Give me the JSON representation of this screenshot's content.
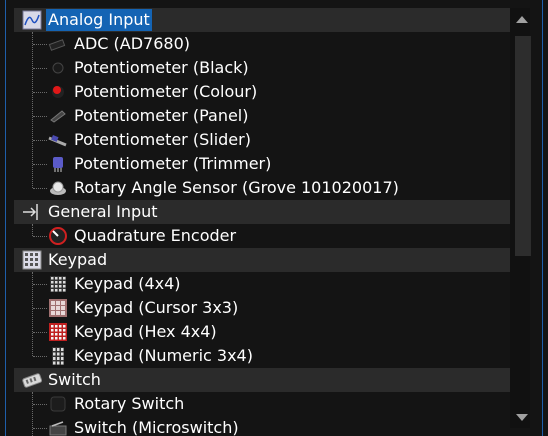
{
  "tree": {
    "categories": [
      {
        "label": "Analog Input",
        "icon": "analog-input-icon",
        "selected": true,
        "children": [
          {
            "label": "ADC (AD7680)",
            "icon": "adc-chip-icon"
          },
          {
            "label": "Potentiometer (Black)",
            "icon": "black-knob-icon"
          },
          {
            "label": "Potentiometer (Colour)",
            "icon": "red-knob-icon"
          },
          {
            "label": "Potentiometer (Panel)",
            "icon": "panel-pot-icon"
          },
          {
            "label": "Potentiometer (Slider)",
            "icon": "slider-pot-icon"
          },
          {
            "label": "Potentiometer (Trimmer)",
            "icon": "trimmer-pot-icon"
          },
          {
            "label": "Rotary Angle Sensor (Grove 101020017)",
            "icon": "rotary-sensor-icon"
          }
        ]
      },
      {
        "label": "General Input",
        "icon": "general-input-icon",
        "children": [
          {
            "label": "Quadrature Encoder",
            "icon": "encoder-dial-icon"
          }
        ]
      },
      {
        "label": "Keypad",
        "icon": "keypad-icon",
        "children": [
          {
            "label": "Keypad (4x4)",
            "icon": "keypad-4x4-icon"
          },
          {
            "label": "Keypad (Cursor 3x3)",
            "icon": "keypad-cursor-icon"
          },
          {
            "label": "Keypad (Hex 4x4)",
            "icon": "keypad-hex-icon"
          },
          {
            "label": "Keypad (Numeric 3x4)",
            "icon": "keypad-numeric-icon"
          }
        ]
      },
      {
        "label": "Switch",
        "icon": "switch-icon",
        "children": [
          {
            "label": "Rotary Switch",
            "icon": "rotary-switch-icon"
          },
          {
            "label": "Switch (Microswitch)",
            "icon": "microswitch-icon"
          }
        ]
      }
    ]
  },
  "scrollbar": {
    "up_icon": "scroll-up-arrow-icon",
    "down_icon": "scroll-down-arrow-icon"
  },
  "colors": {
    "selection": "#1464b4",
    "category_row": "#2b2b2b",
    "background": "#141414"
  }
}
